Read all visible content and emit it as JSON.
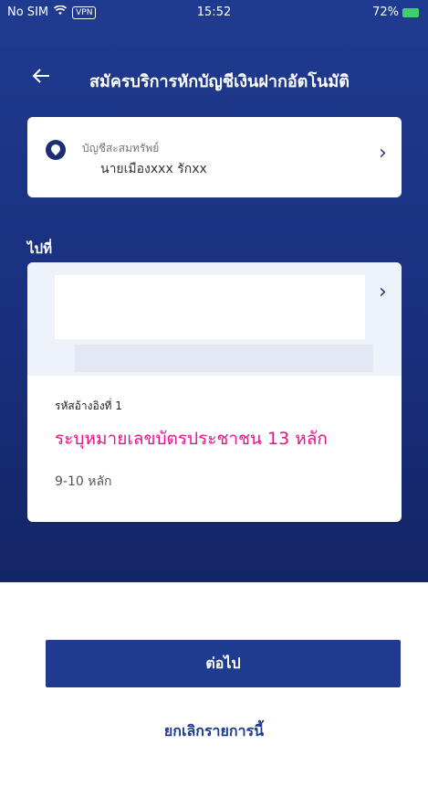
{
  "status_bar": {
    "carrier": "No SIM",
    "vpn": "VPN",
    "time": "15:52",
    "battery": "72%"
  },
  "header": {
    "back_icon": "arrow-left-icon",
    "title": "สมัครบริการหักบัญชีเงินฝากอัตโนมัติ"
  },
  "source_account": {
    "icon": "coin-icon",
    "label": "บัญชีสะสมทรัพย์",
    "name": "นายเมืองxxx รักxx"
  },
  "destination": {
    "section_label": "ไปที่",
    "ref1_label": "รหัสอ้างอิงที่ 1",
    "ref1_value": "ระบุหมายเลขบัตรประชาชน 13 หลัก",
    "ref1_hint": "9-10 หลัก"
  },
  "footer": {
    "next_label": "ต่อไป",
    "cancel_label": "ยกเลิกรายการนี้"
  },
  "colors": {
    "primary": "#1f3b8f",
    "highlight": "#e0158c"
  }
}
